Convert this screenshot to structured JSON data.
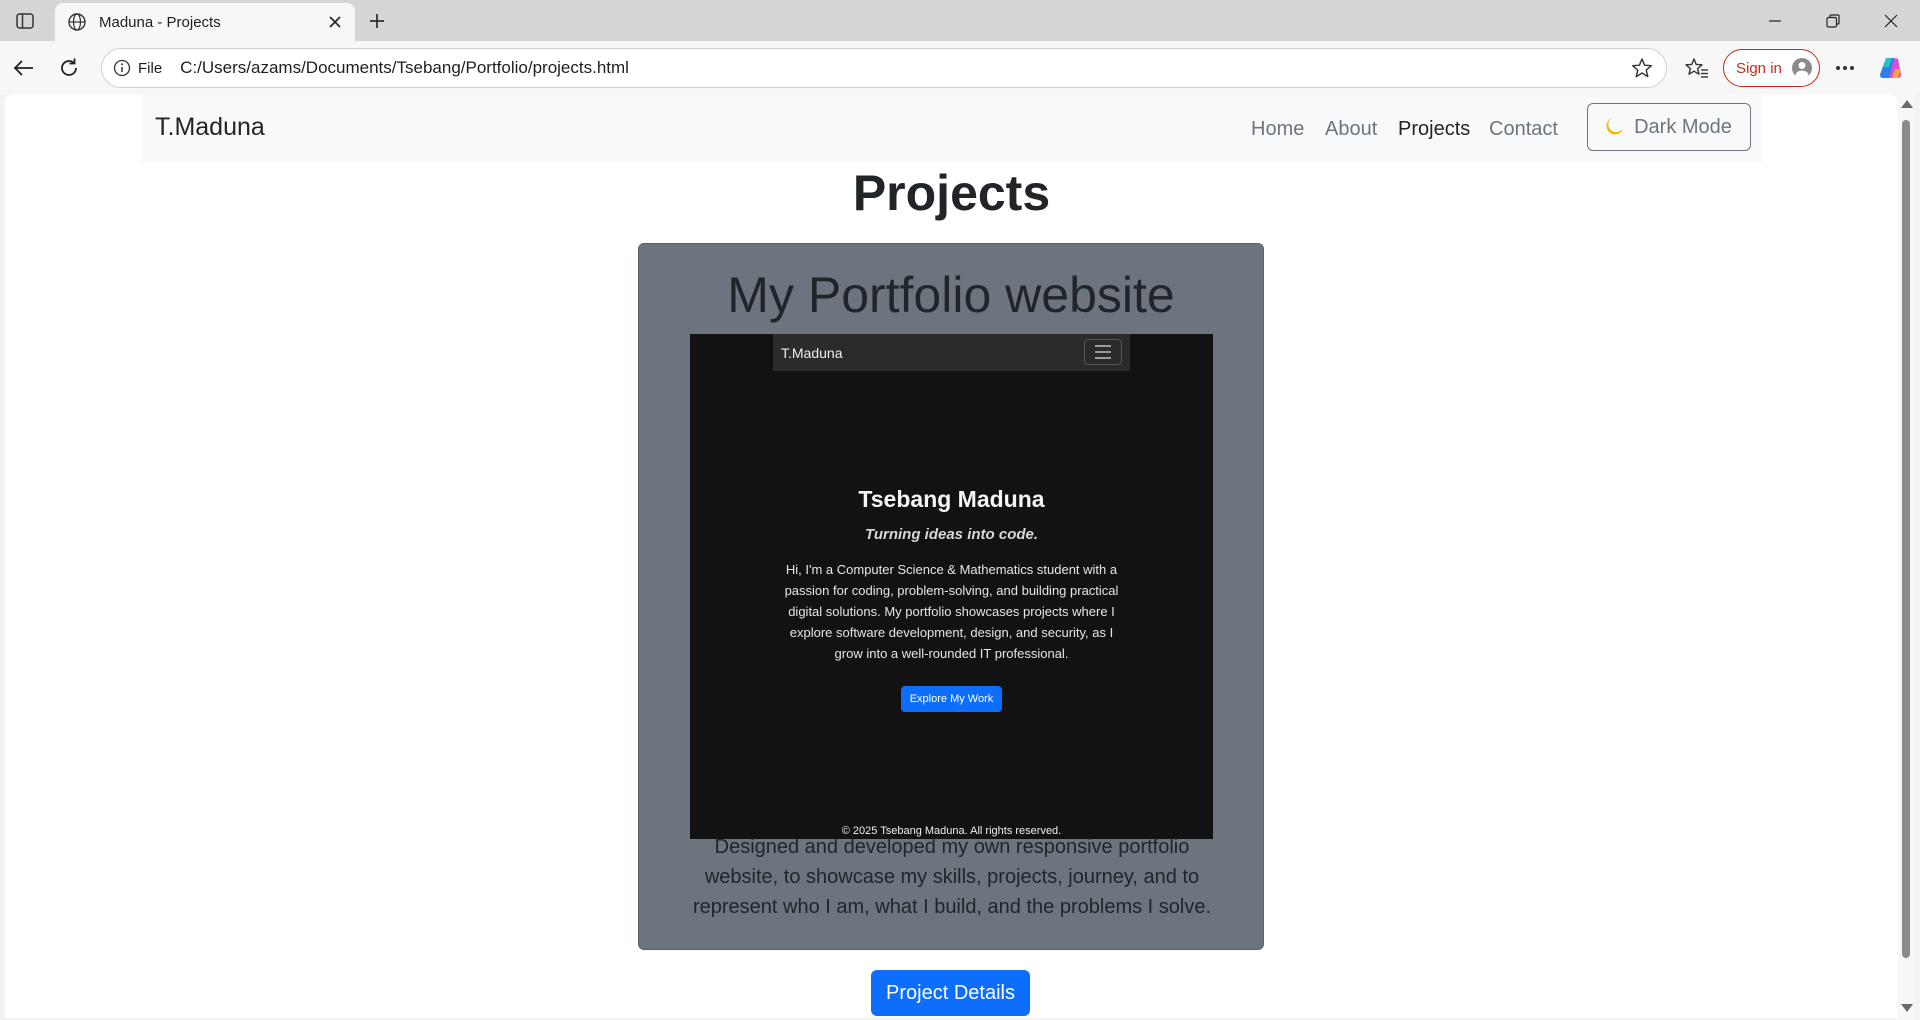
{
  "browser": {
    "tab_title": "Maduna - Projects",
    "address_scheme": "File",
    "address_url": "C:/Users/azams/Documents/Tsebang/Portfolio/projects.html",
    "signin_label": "Sign in",
    "icons": [
      "sidebar-icon",
      "globe-icon",
      "close-icon",
      "plus-icon",
      "minimize-icon",
      "restore-icon",
      "back-icon",
      "refresh-icon",
      "info-icon",
      "star-icon",
      "favorites-icon",
      "more-icon",
      "copilot-icon"
    ],
    "accent": "#c42b1c"
  },
  "site_nav": {
    "brand": "T.Maduna",
    "links": [
      "Home",
      "About",
      "Projects",
      "Contact"
    ],
    "active": "Projects",
    "dark_mode_label": "Dark Mode"
  },
  "page": {
    "title": "Projects"
  },
  "project": {
    "title": "My Portfolio website",
    "description": "Designed and developed my own responsive portfolio website, to showcase my skills, projects, journey, and to represent who I am, what I build, and the problems I solve.",
    "details_button": "Project Details",
    "card_color": "#6c757d",
    "button_color": "#0d6efd"
  },
  "preview": {
    "brand": "T.Maduna",
    "name": "Tsebang Maduna",
    "tagline": "Turning ideas into code.",
    "paragraph": "Hi, I'm a Computer Science & Mathematics student with a passion for coding, problem-solving, and building practical digital solutions. My portfolio showcases projects where I explore software development, design, and security, as I grow into a well-rounded IT professional.",
    "button": "Explore My Work",
    "footer": "© 2025 Tsebang Maduna. All rights reserved."
  }
}
